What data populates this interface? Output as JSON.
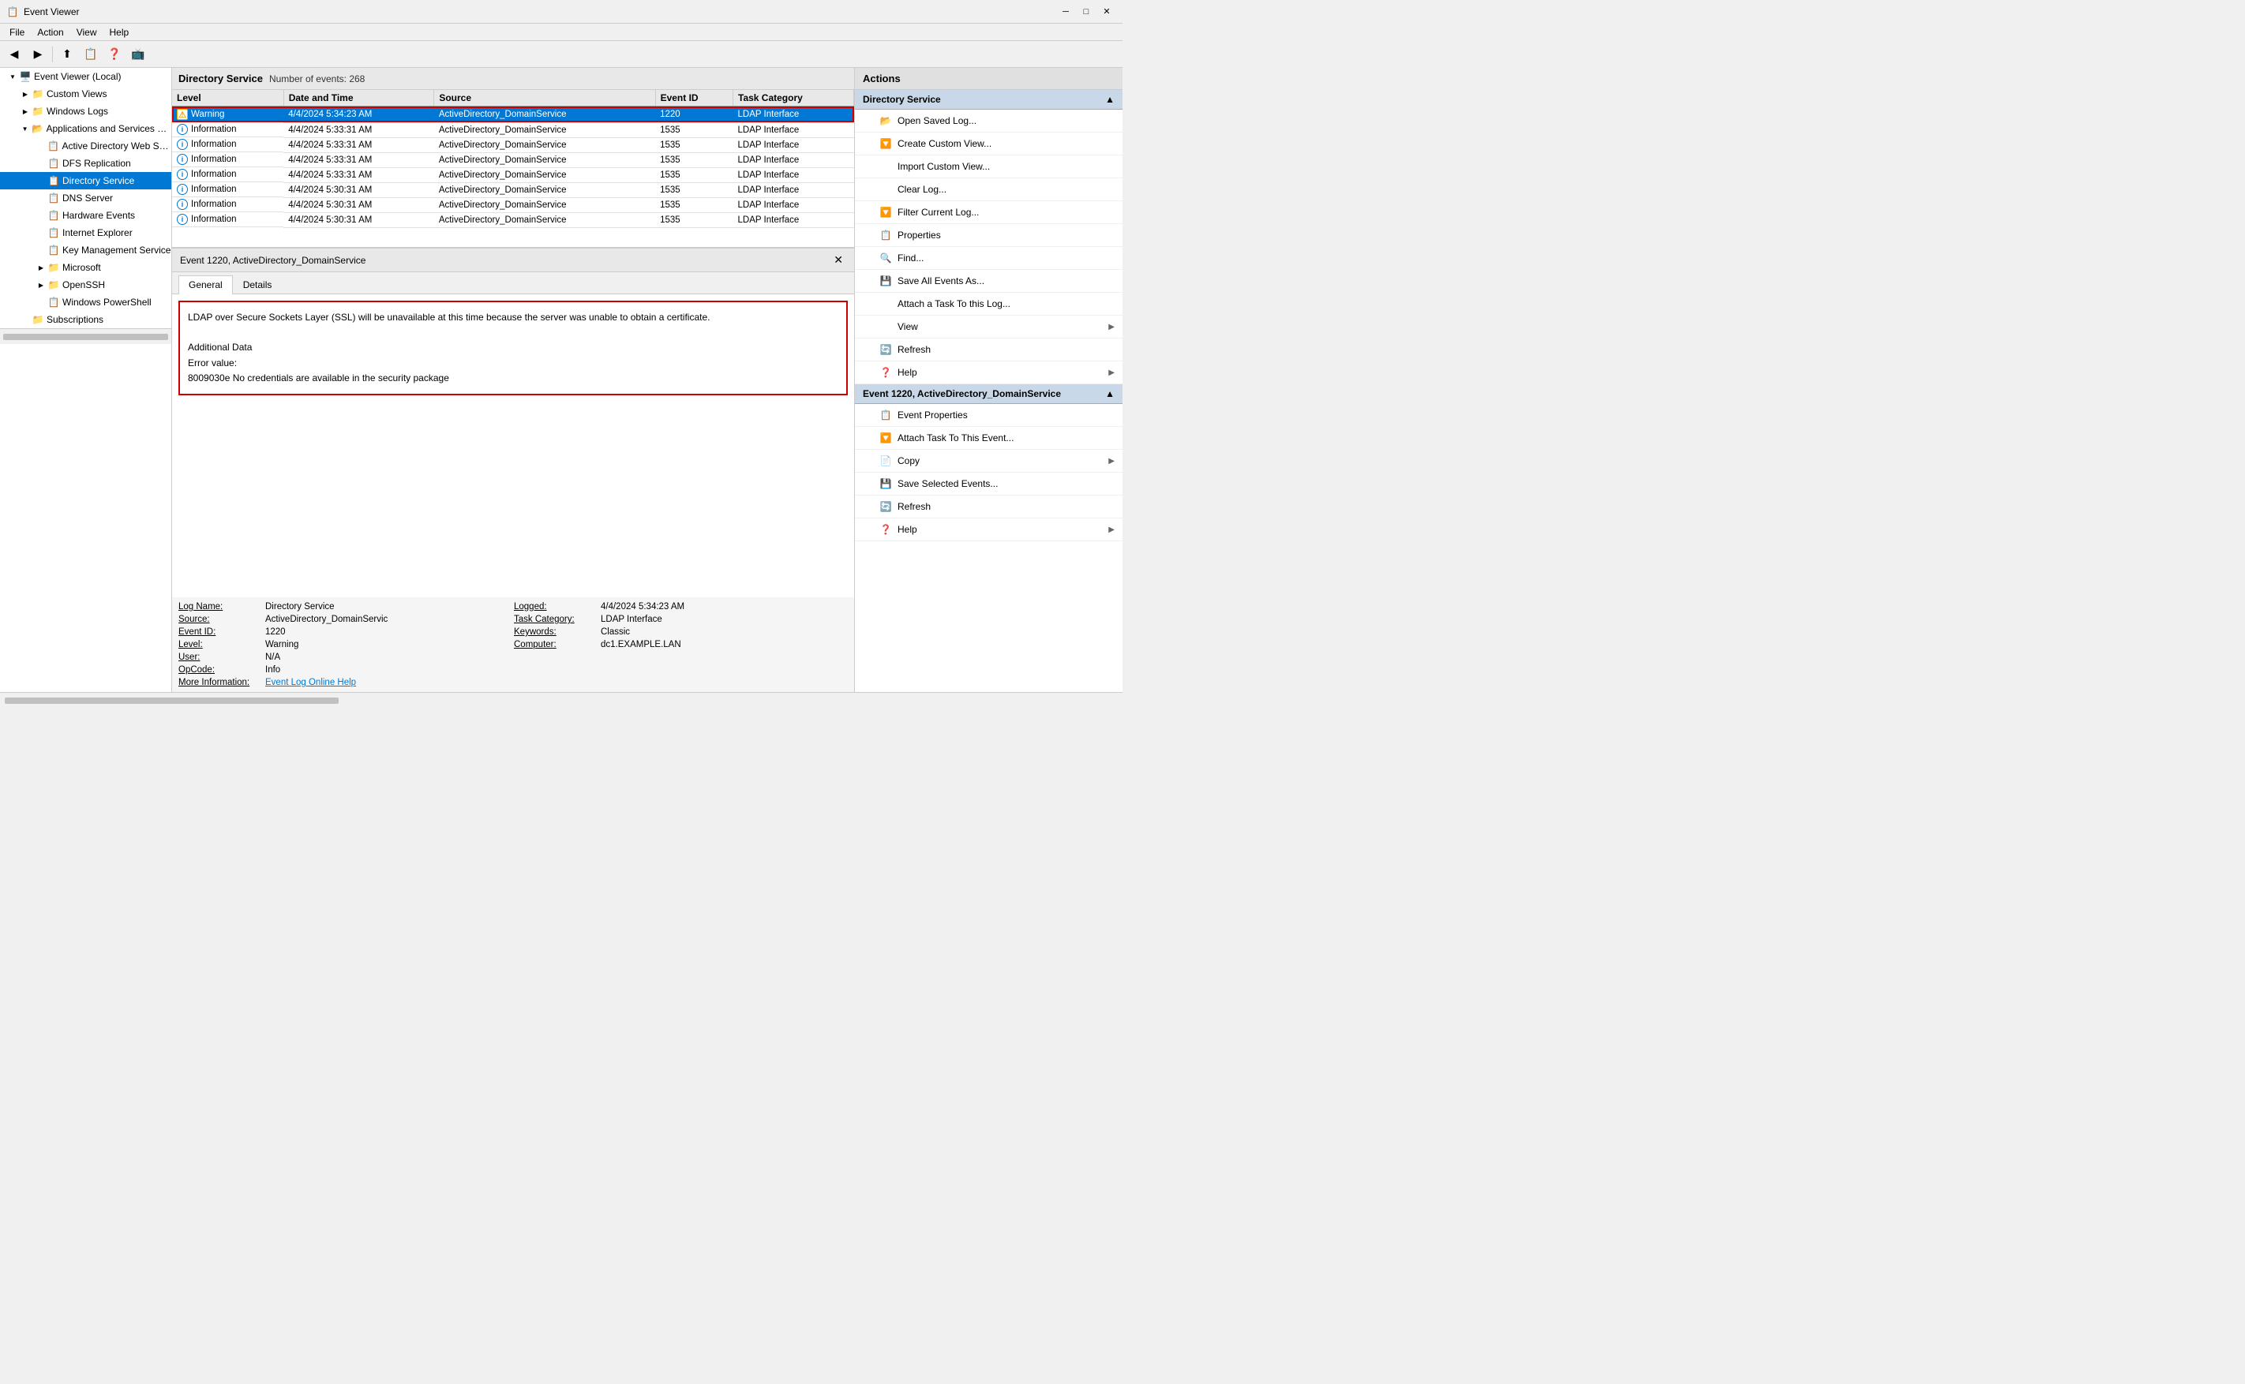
{
  "titlebar": {
    "title": "Event Viewer",
    "icon": "📋",
    "minimize": "─",
    "maximize": "□",
    "close": "✕"
  },
  "menubar": {
    "items": [
      "File",
      "Action",
      "View",
      "Help"
    ]
  },
  "toolbar": {
    "buttons": [
      "◀",
      "▶",
      "⬆",
      "📋",
      "❓",
      "📺"
    ]
  },
  "sidebar": {
    "root": {
      "label": "Event Viewer (Local)",
      "expanded": true
    },
    "items": [
      {
        "id": "custom-views",
        "label": "Custom Views",
        "level": 1,
        "expanded": false,
        "type": "folder"
      },
      {
        "id": "windows-logs",
        "label": "Windows Logs",
        "level": 1,
        "expanded": false,
        "type": "folder"
      },
      {
        "id": "app-services",
        "label": "Applications and Services Log",
        "level": 1,
        "expanded": true,
        "type": "folder"
      },
      {
        "id": "active-directory-web",
        "label": "Active Directory Web Serv",
        "level": 2,
        "type": "log"
      },
      {
        "id": "dfs-replication",
        "label": "DFS Replication",
        "level": 2,
        "type": "log"
      },
      {
        "id": "directory-service",
        "label": "Directory Service",
        "level": 2,
        "type": "log",
        "selected": true
      },
      {
        "id": "dns-server",
        "label": "DNS Server",
        "level": 2,
        "type": "log"
      },
      {
        "id": "hardware-events",
        "label": "Hardware Events",
        "level": 2,
        "type": "log"
      },
      {
        "id": "internet-explorer",
        "label": "Internet Explorer",
        "level": 2,
        "type": "log"
      },
      {
        "id": "key-management",
        "label": "Key Management Service",
        "level": 2,
        "type": "log"
      },
      {
        "id": "microsoft",
        "label": "Microsoft",
        "level": 2,
        "type": "folder",
        "expanded": false
      },
      {
        "id": "openssh",
        "label": "OpenSSH",
        "level": 2,
        "type": "folder",
        "expanded": false
      },
      {
        "id": "windows-powershell",
        "label": "Windows PowerShell",
        "level": 2,
        "type": "log"
      },
      {
        "id": "subscriptions",
        "label": "Subscriptions",
        "level": 1,
        "type": "folder"
      }
    ]
  },
  "log_header": {
    "title": "Directory Service",
    "count_label": "Number of events: 268"
  },
  "table": {
    "columns": [
      "Level",
      "Date and Time",
      "Source",
      "Event ID",
      "Task Category"
    ],
    "rows": [
      {
        "level": "Warning",
        "level_type": "warning",
        "datetime": "4/4/2024 5:34:23 AM",
        "source": "ActiveDirectory_DomainService",
        "event_id": "1220",
        "task_category": "LDAP Interface",
        "selected": true
      },
      {
        "level": "Information",
        "level_type": "info",
        "datetime": "4/4/2024 5:33:31 AM",
        "source": "ActiveDirectory_DomainService",
        "event_id": "1535",
        "task_category": "LDAP Interface",
        "selected": false
      },
      {
        "level": "Information",
        "level_type": "info",
        "datetime": "4/4/2024 5:33:31 AM",
        "source": "ActiveDirectory_DomainService",
        "event_id": "1535",
        "task_category": "LDAP Interface",
        "selected": false
      },
      {
        "level": "Information",
        "level_type": "info",
        "datetime": "4/4/2024 5:33:31 AM",
        "source": "ActiveDirectory_DomainService",
        "event_id": "1535",
        "task_category": "LDAP Interface",
        "selected": false
      },
      {
        "level": "Information",
        "level_type": "info",
        "datetime": "4/4/2024 5:33:31 AM",
        "source": "ActiveDirectory_DomainService",
        "event_id": "1535",
        "task_category": "LDAP Interface",
        "selected": false
      },
      {
        "level": "Information",
        "level_type": "info",
        "datetime": "4/4/2024 5:30:31 AM",
        "source": "ActiveDirectory_DomainService",
        "event_id": "1535",
        "task_category": "LDAP Interface",
        "selected": false
      },
      {
        "level": "Information",
        "level_type": "info",
        "datetime": "4/4/2024 5:30:31 AM",
        "source": "ActiveDirectory_DomainService",
        "event_id": "1535",
        "task_category": "LDAP Interface",
        "selected": false
      },
      {
        "level": "Information",
        "level_type": "info",
        "datetime": "4/4/2024 5:30:31 AM",
        "source": "ActiveDirectory_DomainService",
        "event_id": "1535",
        "task_category": "LDAP Interface",
        "selected": false
      }
    ]
  },
  "event_detail": {
    "header": "Event 1220, ActiveDirectory_DomainService",
    "tabs": [
      "General",
      "Details"
    ],
    "active_tab": "General",
    "message": "LDAP over Secure Sockets Layer (SSL) will be unavailable at this time because the server was unable to obtain a certificate.\n\nAdditional Data\nError value:\n8009030e No credentials are available in the security package",
    "metadata": {
      "log_name_label": "Log Name:",
      "log_name_value": "Directory Service",
      "source_label": "Source:",
      "source_value": "ActiveDirectory_DomainServic",
      "logged_label": "Logged:",
      "logged_value": "4/4/2024 5:34:23 AM",
      "event_id_label": "Event ID:",
      "event_id_value": "1220",
      "task_category_label": "Task Category:",
      "task_category_value": "LDAP Interface",
      "level_label": "Level:",
      "level_value": "Warning",
      "keywords_label": "Keywords:",
      "keywords_value": "Classic",
      "user_label": "User:",
      "user_value": "N/A",
      "computer_label": "Computer:",
      "computer_value": "dc1.EXAMPLE.LAN",
      "opcode_label": "OpCode:",
      "opcode_value": "Info",
      "more_info_label": "More Information:",
      "more_info_link": "Event Log Online Help"
    }
  },
  "actions": {
    "header": "Actions",
    "sections": [
      {
        "title": "Directory Service",
        "items": [
          {
            "label": "Open Saved Log...",
            "icon": "📂",
            "arrow": false
          },
          {
            "label": "Create Custom View...",
            "icon": "🔽",
            "arrow": false
          },
          {
            "label": "Import Custom View...",
            "icon": "",
            "arrow": false
          },
          {
            "label": "Clear Log...",
            "icon": "",
            "arrow": false
          },
          {
            "label": "Filter Current Log...",
            "icon": "🔽",
            "arrow": false
          },
          {
            "label": "Properties",
            "icon": "📋",
            "arrow": false
          },
          {
            "label": "Find...",
            "icon": "🔍",
            "arrow": false
          },
          {
            "label": "Save All Events As...",
            "icon": "💾",
            "arrow": false
          },
          {
            "label": "Attach a Task To this Log...",
            "icon": "",
            "arrow": false
          },
          {
            "label": "View",
            "icon": "",
            "arrow": true
          },
          {
            "label": "Refresh",
            "icon": "🔄",
            "arrow": false
          },
          {
            "label": "Help",
            "icon": "❓",
            "arrow": true
          }
        ]
      },
      {
        "title": "Event 1220, ActiveDirectory_DomainService",
        "items": [
          {
            "label": "Event Properties",
            "icon": "📋",
            "arrow": false
          },
          {
            "label": "Attach Task To This Event...",
            "icon": "🔽",
            "arrow": false
          },
          {
            "label": "Copy",
            "icon": "📄",
            "arrow": true
          },
          {
            "label": "Save Selected Events...",
            "icon": "💾",
            "arrow": false
          },
          {
            "label": "Refresh",
            "icon": "🔄",
            "arrow": false
          },
          {
            "label": "Help",
            "icon": "❓",
            "arrow": true
          }
        ]
      }
    ]
  }
}
